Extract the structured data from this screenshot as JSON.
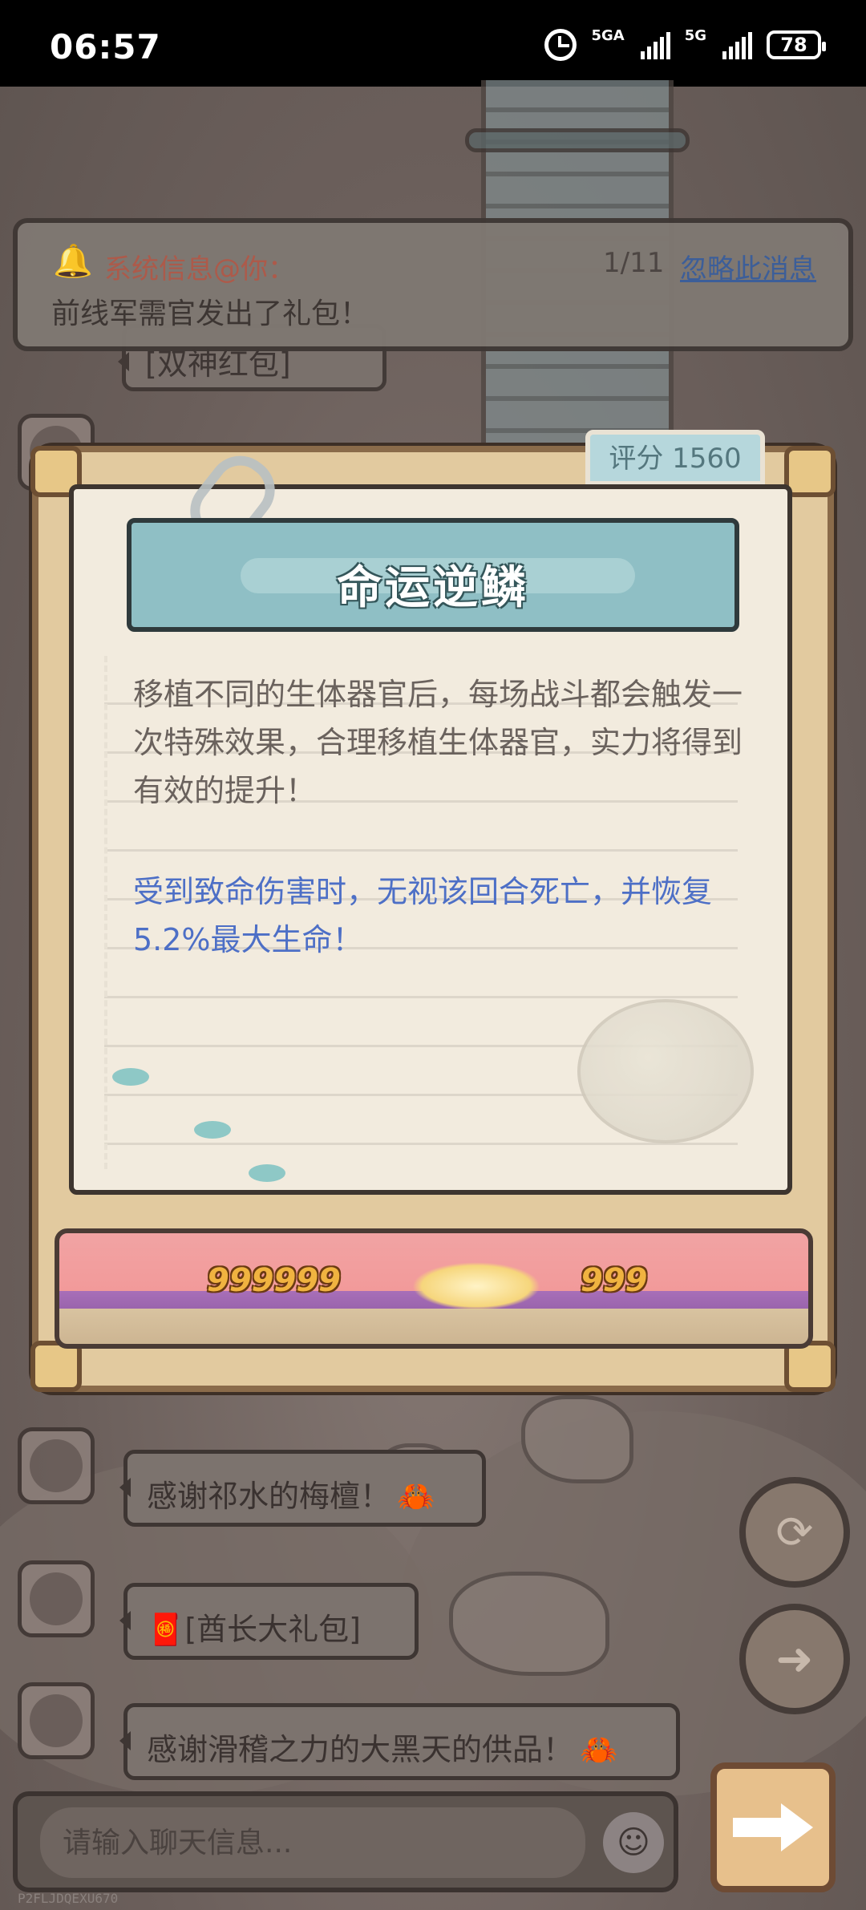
{
  "status_bar": {
    "time": "06:57",
    "network1": "5GA",
    "network2": "5G",
    "battery": "78"
  },
  "notification": {
    "title": "系统信息@你：",
    "count": "1/11",
    "ignore_label": "忽略此消息",
    "body": "前线军需官发出了礼包！"
  },
  "chat": {
    "messages": [
      {
        "text": "感谢祁水的梅檀！"
      },
      {
        "text": "[酋长大礼包]"
      },
      {
        "text": "感谢滑稽之力的大黑天的供品！"
      }
    ],
    "hidden_message": "[双神红包]",
    "input_placeholder": "请输入聊天信息..."
  },
  "modal": {
    "score_label": "评分 1560",
    "title": "命运逆鳞",
    "description": "移植不同的生体器官后，每场战斗都会触发一次特殊效果，合理移植生体器官，实力将得到有效的提升！",
    "effect": "受到致命伤害时，无视该回合死亡，并恢复5.2%最大生命！",
    "battle_damage_left": "999999",
    "battle_damage_right": "999"
  },
  "colors": {
    "effect_text": "#4d6fc6",
    "title_banner": "#8fbfc5",
    "notif_link": "#3b5f9c"
  }
}
